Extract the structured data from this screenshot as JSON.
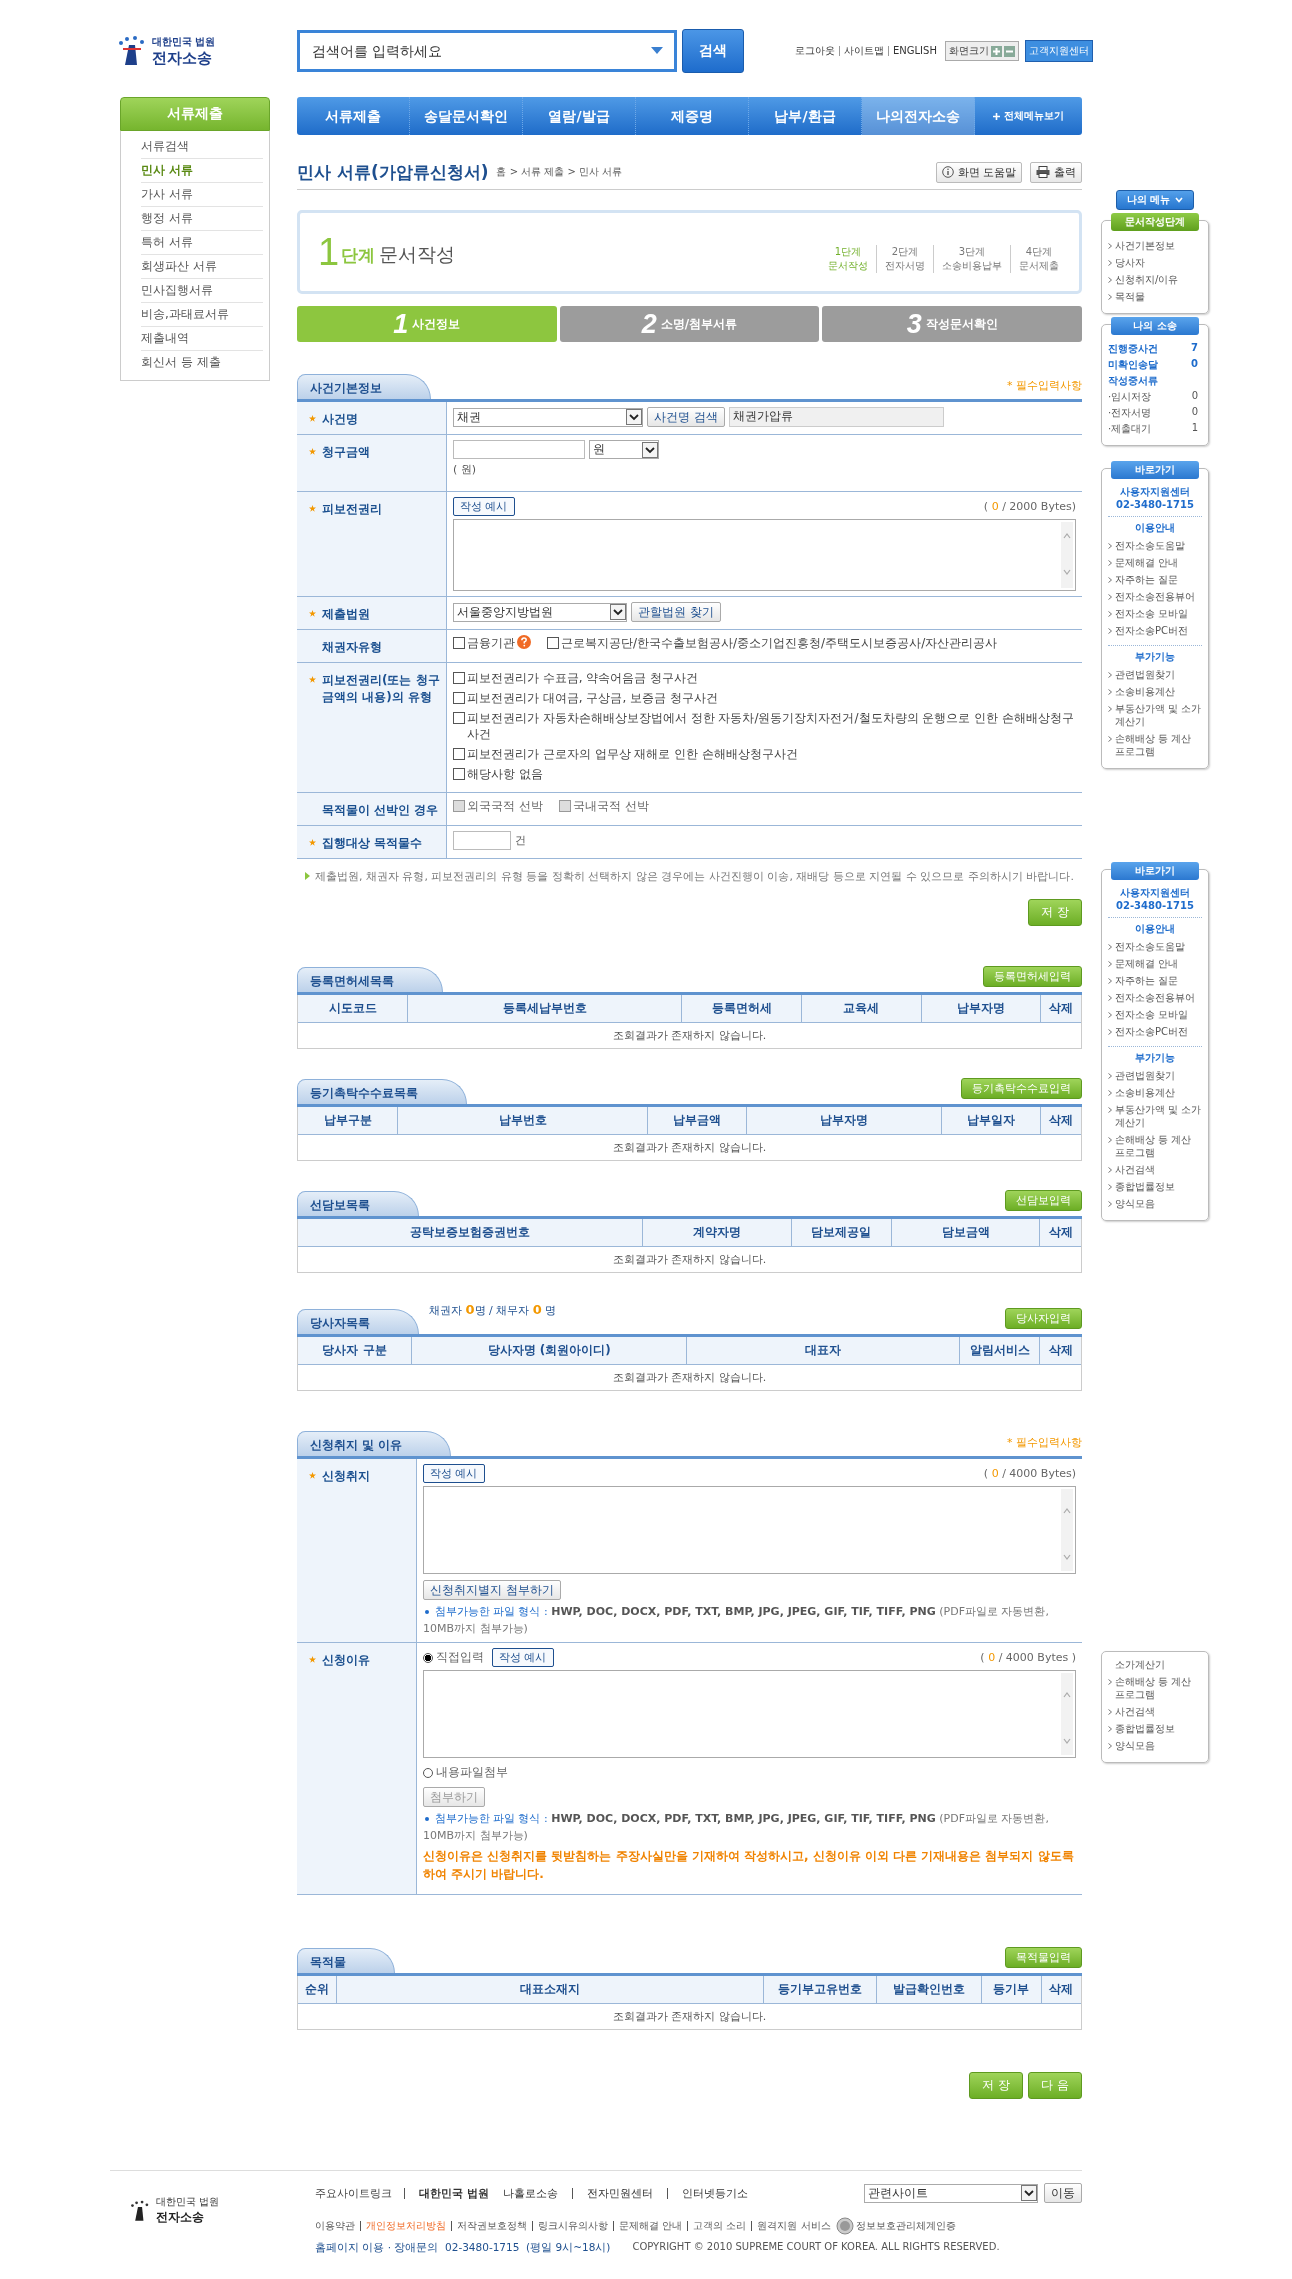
{
  "header": {
    "logo": {
      "org": "대한민국 법원",
      "name": "전자소송"
    },
    "search": {
      "placeholder": "검색어를 입력하세요",
      "button": "검색"
    },
    "util_links": [
      "로그아웃",
      "사이트맵",
      "ENGLISH"
    ],
    "zoom_label": "화면크기",
    "support": "고객지원센터"
  },
  "nav": {
    "items": [
      {
        "label": "서류제출",
        "selected": false
      },
      {
        "label": "송달문서확인",
        "selected": false
      },
      {
        "label": "열람/발급",
        "selected": false
      },
      {
        "label": "제증명",
        "selected": false
      },
      {
        "label": "납부/환급",
        "selected": false
      },
      {
        "label": "나의전자소송",
        "selected": true
      }
    ],
    "all_menu": "전체메뉴보기"
  },
  "left_nav": {
    "title": "서류제출",
    "items": [
      {
        "label": "서류검색",
        "selected": false
      },
      {
        "label": "민사 서류",
        "selected": true
      },
      {
        "label": "가사 서류",
        "selected": false
      },
      {
        "label": "행정 서류",
        "selected": false
      },
      {
        "label": "특허 서류",
        "selected": false
      },
      {
        "label": "회생파산 서류",
        "selected": false
      },
      {
        "label": "민사집행서류",
        "selected": false
      },
      {
        "label": "비송,과태료서류",
        "selected": false
      },
      {
        "label": "제출내역",
        "selected": false
      },
      {
        "label": "회신서 등 제출",
        "selected": false
      }
    ]
  },
  "page": {
    "title": "민사 서류(가압류신청서)",
    "breadcrumb": "홈 > 서류 제출 > 민사 서류",
    "help": "화면 도움말",
    "print": "출력"
  },
  "step_box": {
    "number": "1",
    "unit": "단계",
    "title": "문서작성",
    "steps": [
      {
        "step": "1단계",
        "name": "문서작성",
        "selected": true
      },
      {
        "step": "2단계",
        "name": "전자서명",
        "selected": false
      },
      {
        "step": "3단계",
        "name": "소송비용납부",
        "selected": false
      },
      {
        "step": "4단계",
        "name": "문서제출",
        "selected": false
      }
    ]
  },
  "step_tabs": [
    {
      "number": "1",
      "label": "사건정보",
      "selected": true
    },
    {
      "number": "2",
      "label": "소명/첨부서류",
      "selected": false
    },
    {
      "number": "3",
      "label": "작성문서확인",
      "selected": false
    }
  ],
  "case_info": {
    "title": "사건기본정보",
    "required_note": "* 필수입력사항",
    "rows": [
      {
        "kind": "case_name",
        "label": "사건명",
        "required": true,
        "select": "채권",
        "button": "사건명 검색",
        "value": "채권가압류"
      },
      {
        "kind": "amount",
        "label": "청구금액",
        "required": true,
        "unit_select": "원",
        "note": "( 원)"
      },
      {
        "kind": "text",
        "label": "피보전권리",
        "required": true,
        "example": "작성 예시",
        "counter_open": "(",
        "count": "0",
        "counter_rest": "/ 2000 Bytes)"
      },
      {
        "kind": "court",
        "label": "제출법원",
        "required": true,
        "select": "서울중앙지방법원",
        "button": "관할법원 찾기"
      },
      {
        "kind": "checks",
        "label": "채권자유형",
        "required": false,
        "options": [
          {
            "label": "금융기관",
            "checked": false,
            "disabled": false,
            "help": true
          },
          {
            "label": "근로복지공단/한국수출보험공사/중소기업진흥청/주택도시보증공사/자산관리공사",
            "checked": false,
            "disabled": false,
            "help": false
          }
        ]
      },
      {
        "kind": "list",
        "label": "피보전권리(또는 청구금액의 내용)의 유형",
        "required": true,
        "options": [
          {
            "label": "피보전권리가 수표금, 약속어음금 청구사건",
            "checked": false,
            "disabled": false,
            "help": false
          },
          {
            "label": "피보전권리가 대여금, 구상금, 보증금 청구사건",
            "checked": false,
            "disabled": false,
            "help": false
          },
          {
            "label": "피보전권리가 자동차손해배상보장법에서 정한 자동차/원동기장치자전거/철도차량의 운행으로 인한 손해배상청구사건",
            "checked": false,
            "disabled": false,
            "help": false
          },
          {
            "label": "피보전권리가 근로자의 업무상 재해로 인한 손해배상청구사건",
            "checked": false,
            "disabled": false,
            "help": false
          },
          {
            "label": "해당사항 없음",
            "checked": false,
            "disabled": false,
            "help": false
          }
        ]
      },
      {
        "kind": "checks",
        "label": "목적물이 선박인 경우",
        "required": false,
        "options": [
          {
            "label": "외국국적 선박",
            "checked": false,
            "disabled": true,
            "help": false
          },
          {
            "label": "국내국적 선박",
            "checked": false,
            "disabled": true,
            "help": false
          }
        ]
      },
      {
        "kind": "count",
        "label": "집행대상 목적물수",
        "required": true,
        "unit": "건"
      }
    ],
    "note": "제출법원, 채권자 유형, 피보전권리의 유형 등을 정확히 선택하지 않은 경우에는 사건진행이 이송, 재배당 등으로 지연될 수 있으므로 주의하시기 바랍니다.",
    "save": "저 장"
  },
  "lists": [
    {
      "title": "등록면허세목록",
      "add": "등록면허세입력",
      "columns": [
        "시도코드",
        "등록세납부번호",
        "등록면허세",
        "교육세",
        "납부자명",
        "삭제"
      ],
      "empty": "조회결과가 존재하지 않습니다."
    },
    {
      "title": "등기촉탁수수료목록",
      "add": "등기촉탁수수료입력",
      "columns": [
        "납부구분",
        "납부번호",
        "납부금액",
        "납부자명",
        "납부일자",
        "삭제"
      ],
      "empty": "조회결과가 존재하지 않습니다."
    },
    {
      "title": "선담보목록",
      "add": "선담보입력",
      "columns": [
        "공탁보증보험증권번호",
        "계약자명",
        "담보제공일",
        "담보금액",
        "삭제"
      ],
      "empty": "조회결과가 존재하지 않습니다."
    },
    {
      "title": "당사자목록",
      "add": "당사자입력",
      "counts": {
        "creditor": "채권자",
        "creditor_n": "0",
        "debtor": "명 / 채무자",
        "debtor_n": "0",
        "unit": "명"
      },
      "columns": [
        "당사자 구분",
        "당사자명 (회원아이디)",
        "대표자",
        "알림서비스",
        "삭제"
      ],
      "empty": "조회결과가 존재하지 않습니다."
    }
  ],
  "application": {
    "title": "신청취지 및 이유",
    "required_note": "* 필수입력사항",
    "purpose": {
      "label": "신청취지",
      "required": true,
      "example": "작성 예시",
      "counter_open": "(",
      "count": "0",
      "counter_rest": "/ 4000 Bytes)",
      "attach": "신청취지별지 첨부하기",
      "file_label": "첨부가능한 파일 형식 :",
      "file_types": "HWP, DOC, DOCX, PDF, TXT, BMP, JPG, JPEG, GIF, TIF, TIFF, PNG",
      "file_extra": "(PDF파일로 자동변환, 10MB까지 첨부가능)"
    },
    "reason": {
      "label": "신청이유",
      "required": true,
      "modes": [
        {
          "label": "직접입력",
          "selected": true
        },
        {
          "label": "내용파일첨부",
          "selected": false
        }
      ],
      "example": "작성 예시",
      "counter_open": "(",
      "count": "0",
      "counter_rest": "/ 4000 Bytes )",
      "attach": "첨부하기",
      "attach_disabled": true,
      "file_label": "첨부가능한 파일 형식 :",
      "file_types": "HWP, DOC, DOCX, PDF, TXT, BMP, JPG, JPEG, GIF, TIF, TIFF, PNG",
      "file_extra": "(PDF파일로 자동변환, 10MB까지 첨부가능)",
      "warning": "신청이유은 신청취지를 뒷받침하는 주장사실만을 기재하여 작성하시고, 신청이유 이외 다른 기재내용은 첨부되지 않도록 하여 주시기 바랍니다."
    }
  },
  "property": {
    "title": "목적물",
    "add": "목적물입력",
    "columns": [
      "순위",
      "대표소재지",
      "등기부고유번호",
      "발급확인번호",
      "등기부",
      "삭제"
    ],
    "empty": "조회결과가 존재하지 않습니다."
  },
  "actions": [
    "저 장",
    "다 음"
  ],
  "footer": {
    "logo": {
      "org": "대한민국 법원",
      "name": "전자소송"
    },
    "links_title": "주요사이트링크",
    "links": [
      "대한민국 법원",
      "나홀로소송",
      "전자민원센터",
      "인터넷등기소"
    ],
    "related": "관련사이트",
    "go": "이동",
    "policies": [
      {
        "label": "이용약관",
        "highlight": false
      },
      {
        "label": "개인정보처리방침",
        "highlight": true
      },
      {
        "label": "저작권보호정책",
        "highlight": false
      },
      {
        "label": "링크시유의사항",
        "highlight": false
      },
      {
        "label": "문제해결 안내",
        "highlight": false
      },
      {
        "label": "고객의 소리",
        "highlight": false
      },
      {
        "label": "원격지원 서비스",
        "highlight": false
      }
    ],
    "cert": "정보보호관리체계인증",
    "contact": "홈페이지 이용 · 장애문의  02-3480-1715  (평일 9시~18시)",
    "copyright": "COPYRIGHT © 2010 SUPREME COURT OF KOREA. ALL RIGHTS RESERVED."
  },
  "sidebar": {
    "my_menu": "나의 메뉴",
    "steps_panel": {
      "title": "문서작성단계",
      "items": [
        "사건기본정보",
        "당사자",
        "신청취지/이유",
        "목적물"
      ]
    },
    "my_case": {
      "title": "나의 소송",
      "stats": [
        {
          "label": "진행중사건",
          "value": "7"
        },
        {
          "label": "미확인송달",
          "value": "0"
        }
      ],
      "subtitle": "작성중서류",
      "sub_stats": [
        {
          "label": "·임시저장",
          "value": "0"
        },
        {
          "label": "·전자서명",
          "value": "0"
        },
        {
          "label": "·제출대기",
          "value": "1"
        }
      ]
    },
    "quick_panels": [
      {
        "title": "바로가기",
        "center": "사용자지원센터",
        "phone": "02-3480-1715",
        "guide_title": "이용안내",
        "guide": [
          "전자소송도움말",
          "문제해결 안내",
          "자주하는 질문",
          "전자소송전용뷰어",
          "전자소송 모바일",
          "전자소송PC버전"
        ],
        "extra_title": "부가기능",
        "extra": [
          "관련법원찾기",
          "소송비용계산",
          "부동산가액 및 소가계산기",
          "손해배상 등 계산 프로그램"
        ]
      },
      {
        "title": "바로가기",
        "center": "사용자지원센터",
        "phone": "02-3480-1715",
        "guide_title": "이용안내",
        "guide": [
          "전자소송도움말",
          "문제해결 안내",
          "자주하는 질문",
          "전자소송전용뷰어",
          "전자소송 모바일",
          "전자소송PC버전"
        ],
        "extra_title": "부가기능",
        "extra": [
          "관련법원찾기",
          "소송비용계산",
          "부동산가액 및 소가계산기",
          "손해배상 등 계산 프로그램",
          "사건검색",
          "종합법률정보",
          "양식모음"
        ]
      }
    ],
    "fragment": [
      {
        "label": "소가계산기",
        "bullet": false
      },
      {
        "label": "손해배상 등 계산 프로그램",
        "bullet": true
      },
      {
        "label": "사건검색",
        "bullet": true
      },
      {
        "label": "종합법률정보",
        "bullet": true
      },
      {
        "label": "양식모음",
        "bullet": true
      }
    ]
  }
}
